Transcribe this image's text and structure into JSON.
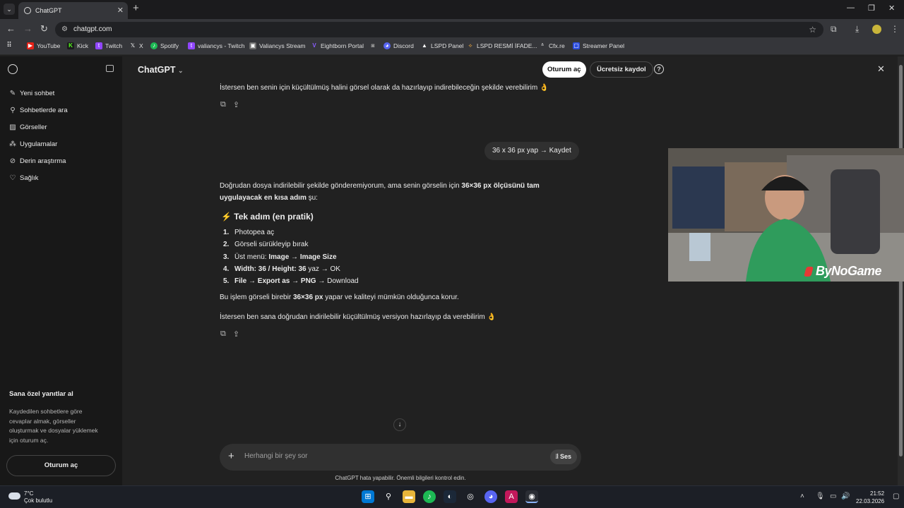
{
  "browser": {
    "tab_title": "ChatGPT",
    "url": "chatgpt.com",
    "bookmarks": [
      "YouTube",
      "Kick",
      "Twitch",
      "X",
      "Spotify",
      "valiancys - Twitch",
      "Valiancys Stream",
      "Eightborn Portal",
      "Discord",
      "LSPD Panel",
      "LSPD  RESMİ İFADE...",
      "Cfx.re",
      "Streamer Panel"
    ]
  },
  "sidebar": {
    "items": [
      "Yeni sohbet",
      "Sohbetlerde ara",
      "Görseller",
      "Uygulamalar",
      "Derin araştırma",
      "Sağlık"
    ],
    "promo_title": "Sana özel yanıtlar al",
    "promo_text": "Kaydedilen sohbetlere göre cevaplar almak, görseller oluşturmak ve dosyalar yüklemek için oturum aç.",
    "login_button": "Oturum aç"
  },
  "header": {
    "model": "ChatGPT",
    "login": "Oturum aç",
    "signup": "Ücretsiz kaydol",
    "help": "?"
  },
  "chat": {
    "prev_answer_end": "İstersen ben senin için küçültülmüş halini görsel olarak da hazırlayıp indirebileceğin şekilde verebilirim 👌",
    "user_message": "36 x 36 px yap → Kaydet",
    "answer_intro_1": "Doğrudan dosya indirilebilir şekilde gönderemiyorum, ama senin görselin için ",
    "answer_intro_bold": "36×36 px ölçüsünü tam uygulayacak en kısa adım",
    "answer_intro_2": " şu:",
    "heading": "Tek adım (en pratik)",
    "heading_icon": "⚡",
    "steps": [
      {
        "n": "1.",
        "a": "Photopea aç",
        "b": "",
        "c": ""
      },
      {
        "n": "2.",
        "a": "Görseli sürükleyip bırak",
        "b": "",
        "c": ""
      },
      {
        "n": "3.",
        "a": "Üst menü: ",
        "b": "Image → Image Size",
        "c": ""
      },
      {
        "n": "4.",
        "a": "",
        "b": "Width: 36 / Height: 36",
        "c": " yaz → OK"
      },
      {
        "n": "5.",
        "a": "",
        "b": "File → Export as → PNG",
        "c": " → Download"
      }
    ],
    "summary_1": "Bu işlem görseli birebir ",
    "summary_bold": "36×36 px",
    "summary_2": " yapar ve kaliteyi mümkün olduğunca korur.",
    "closing": "İstersen ben sana doğrudan indirilebilir küçültülmüş versiyon hazırlayıp da verebilirim 👌"
  },
  "composer": {
    "placeholder": "Herhangi bir şey sor",
    "voice": "Ses",
    "disclaimer": "ChatGPT hata yapabilir. Önemli bilgileri kontrol edin."
  },
  "webcam": {
    "overlay_text": "ByNoGame"
  },
  "taskbar": {
    "temp": "7°C",
    "weather": "Çok bulutlu",
    "time": "21:52",
    "date": "22.03.2026"
  }
}
